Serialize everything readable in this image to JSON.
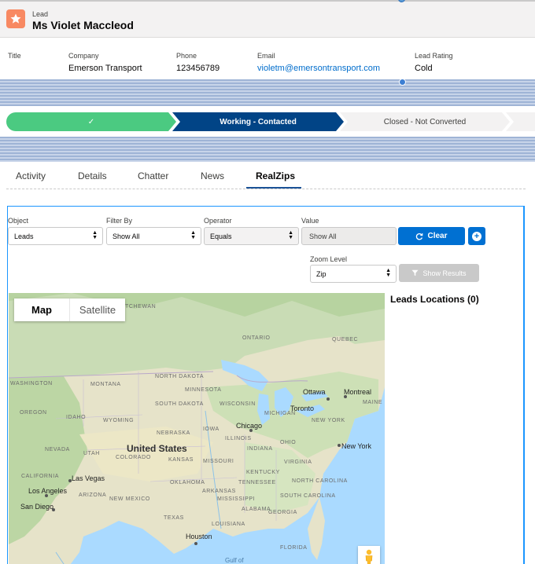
{
  "header": {
    "object_label": "Lead",
    "record_name": "Ms Violet Maccleod"
  },
  "highlights": [
    {
      "label": "Title",
      "value": ""
    },
    {
      "label": "Company",
      "value": "Emerson Transport"
    },
    {
      "label": "Phone",
      "value": "123456789"
    },
    {
      "label": "Email",
      "value": "violetm@emersontransport.com"
    },
    {
      "label": "Lead Rating",
      "value": "Cold"
    }
  ],
  "path": {
    "stages": [
      {
        "label": "✓",
        "state": "complete"
      },
      {
        "label": "Working - Contacted",
        "state": "current"
      },
      {
        "label": "Closed - Not Converted",
        "state": "future"
      }
    ]
  },
  "tabs": [
    {
      "label": "Activity"
    },
    {
      "label": "Details"
    },
    {
      "label": "Chatter"
    },
    {
      "label": "News"
    },
    {
      "label": "RealZips",
      "active": true
    }
  ],
  "filters": {
    "object_label": "Object",
    "object_value": "Leads",
    "filterby_label": "Filter By",
    "filterby_value": "Show All",
    "operator_label": "Operator",
    "operator_value": "Equals",
    "value_label": "Value",
    "value_value": "Show All",
    "clear_button": "Clear",
    "zoom_label": "Zoom Level",
    "zoom_value": "Zip",
    "show_results_button": "Show Results"
  },
  "map": {
    "toggle_map": "Map",
    "toggle_satellite": "Satellite",
    "country": "United States",
    "regions": [
      "ONTARIO",
      "QUEBEC",
      "WASHINGTON",
      "MONTANA",
      "NORTH DAKOTA",
      "MINNESOTA",
      "OREGON",
      "IDAHO",
      "SOUTH DAKOTA",
      "WISCONSIN",
      "WYOMING",
      "MICHIGAN",
      "NEBRASKA",
      "IOWA",
      "ILLINOIS",
      "NEVADA",
      "UTAH",
      "COLORADO",
      "KANSAS",
      "MISSOURI",
      "INDIANA",
      "OHIO",
      "CALIFORNIA",
      "OKLAHOMA",
      "ARIZONA",
      "NEW MEXICO",
      "ARKANSAS",
      "TENNESSEE",
      "TEXAS",
      "MISSISSIPPI",
      "ALABAMA",
      "LOUISIANA",
      "FLORIDA",
      "KENTUCKY",
      "VIRGINIA",
      "NORTH CAROLINA",
      "SOUTH CAROLINA",
      "GEORGIA",
      "MAINE",
      "NEW YORK",
      "TCHEWAN"
    ],
    "cities": [
      "Ottawa",
      "Montreal",
      "Toronto",
      "Chicago",
      "New York",
      "Las Vegas",
      "Los Angeles",
      "San Diego",
      "Houston"
    ],
    "water": "Gulf of"
  },
  "leads_locations": "Leads Locations (0)",
  "colors": {
    "complete": "#4bca81",
    "current": "#014486",
    "button": "#0070d2",
    "lead_icon": "#f88962"
  }
}
